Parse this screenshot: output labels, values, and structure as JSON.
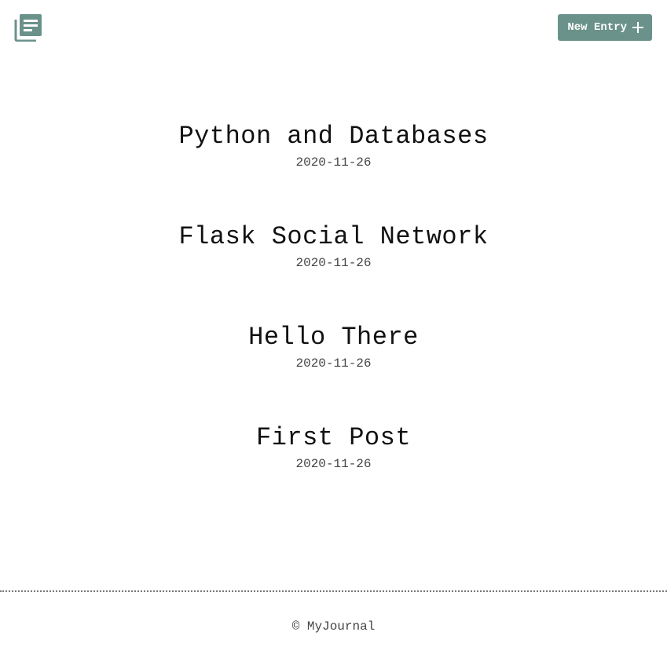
{
  "header": {
    "logo_icon": "journal-icon",
    "new_entry_label": "New Entry",
    "new_entry_icon": "plus-icon",
    "accent_color": "#6a928a"
  },
  "entries": [
    {
      "title": "Python and Databases",
      "date": "2020-11-26"
    },
    {
      "title": "Flask Social Network",
      "date": "2020-11-26"
    },
    {
      "title": "Hello There",
      "date": "2020-11-26"
    },
    {
      "title": "First Post",
      "date": "2020-11-26"
    }
  ],
  "footer": {
    "copyright": "© MyJournal"
  }
}
